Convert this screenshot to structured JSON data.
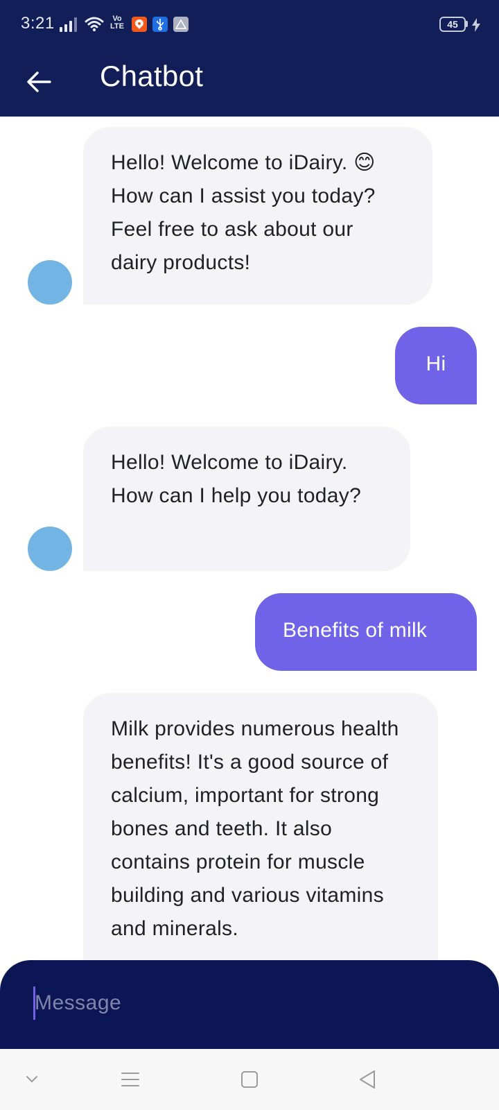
{
  "status_bar": {
    "time": "3:21",
    "volte_label": "Vo\nLTE",
    "battery_level": "45",
    "icons": [
      "signal-icon",
      "wifi-icon",
      "volte-icon",
      "orange-app-icon",
      "usb-icon",
      "gallery-icon",
      "battery-icon",
      "charging-icon"
    ]
  },
  "app_bar": {
    "title": "Chatbot",
    "back_icon": "arrow-left-icon"
  },
  "messages": [
    {
      "sender": "bot",
      "text": "Hello! Welcome to iDairy. 😊 How can I assist you today? Feel free to ask about our dairy products!"
    },
    {
      "sender": "user",
      "text": "Hi"
    },
    {
      "sender": "bot",
      "text": "Hello! Welcome to iDairy. How can I help you today?"
    },
    {
      "sender": "user",
      "text": "Benefits of milk"
    },
    {
      "sender": "bot",
      "text": "Milk provides numerous health benefits!  It's a good source of calcium, important for strong bones and teeth. It also contains protein for muscle building and various vitamins and minerals."
    }
  ],
  "composer": {
    "placeholder": "Message",
    "value": ""
  },
  "system_nav": {
    "icons": [
      "chevron-down-icon",
      "menu-icon",
      "home-icon",
      "back-triangle-icon"
    ]
  },
  "colors": {
    "header_bg": "#111e57",
    "composer_bg": "#0d1654",
    "user_bubble": "#7063e8",
    "bot_bubble": "#f4f4f6",
    "avatar": "#72b4e3"
  }
}
